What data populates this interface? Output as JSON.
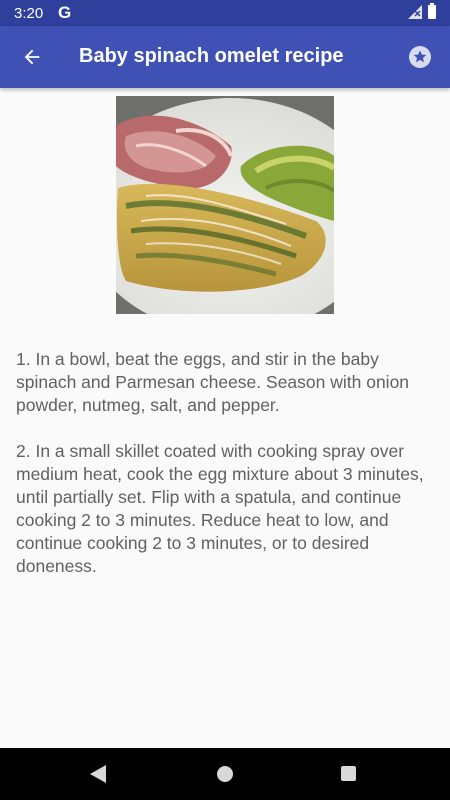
{
  "status_bar": {
    "time": "3:20",
    "g_label": "G"
  },
  "app_bar": {
    "title": "Baby spinach omelet recipe",
    "back_icon": "arrow-back-icon",
    "favorite_icon": "star-circle-icon"
  },
  "recipe": {
    "image_description": "spinach omelet",
    "steps": [
      "1. In a bowl, beat the eggs, and stir in the baby spinach and Parmesan cheese. Season with onion powder, nutmeg, salt, and pepper.",
      "2. In a small skillet coated with cooking spray over medium heat, cook the egg mixture about 3 minutes, until partially set. Flip with a spatula, and continue cooking 2 to 3 minutes. Reduce heat to low, and continue cooking 2 to 3 minutes, or to desired doneness."
    ]
  },
  "colors": {
    "app_bar": "#3f51b5",
    "status_bar": "#2f3f9c",
    "text": "#616161"
  }
}
